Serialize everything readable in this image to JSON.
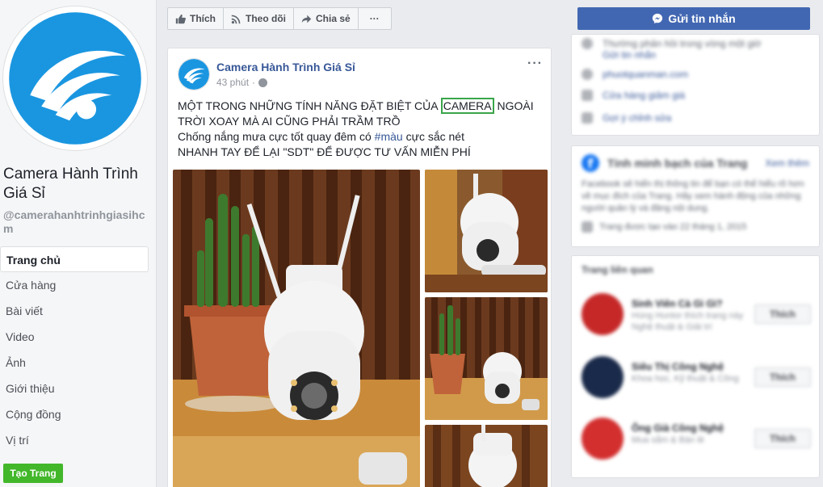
{
  "page": {
    "name": "Camera Hành Trình Giá Sỉ",
    "handle": "@camerahanhtrinhgiasihcm"
  },
  "nav": {
    "items": [
      "Trang chủ",
      "Cửa hàng",
      "Bài viết",
      "Video",
      "Ảnh",
      "Giới thiệu",
      "Cộng đồng",
      "Vị trí"
    ],
    "active_index": 0,
    "create_page": "Tạo Trang"
  },
  "actions": {
    "like": "Thích",
    "follow": "Theo dõi",
    "share": "Chia sẻ",
    "more": "···"
  },
  "post": {
    "author": "Camera Hành Trình Giá Sỉ",
    "time": "43 phút",
    "separator": "·",
    "more": "···",
    "line1_prefix": "MỘT TRONG NHỮNG TÍNH NĂNG ĐẶT BIỆT CỦA ",
    "line1_highlight": "CAMERA",
    "line1_suffix": " NGOÀI",
    "line2": "TRỜI XOAY MÀ AI CŨNG PHẢI TRẦM TRỒ",
    "line3_prefix": "Chống nắng mưa cực tốt quay đêm có ",
    "line3_hashtag": "#màu",
    "line3_suffix": " cực sắc nét",
    "line4": "NHANH TAY ĐỂ LẠI \"SDT\" ĐỂ ĐƯỢC TƯ VẤN MIỄN PHÍ"
  },
  "sidebar": {
    "message_button": "Gửi tin nhắn",
    "info_rows": [
      {
        "text": "Thường phản hồi trong vòng một giờ",
        "link": "Gửi tin nhắn"
      },
      {
        "text": "phuotquanman.com"
      },
      {
        "text": "Cửa hàng giảm giá"
      },
      {
        "text": "Gợi ý chỉnh sửa"
      }
    ],
    "transparency": {
      "title": "Tính minh bạch của Trang",
      "see_more": "Xem thêm",
      "body": "Facebook sẽ hiển thị thông tin để bạn có thể hiểu rõ hơn về mục đích của Trang. Hãy xem hành động của những người quản lý và đăng nội dung.",
      "created": "Trang được tạo vào 22 tháng 1, 2015"
    },
    "related": {
      "title": "Trang liên quan",
      "items": [
        {
          "name": "Sinh Viên Cà Gì Gì?",
          "sub1": "Hùng Huntor thích trang này",
          "sub2": "Nghệ thuật & Giải trí",
          "button": "Thích",
          "color": "#c62828"
        },
        {
          "name": "Siêu Thị Công Nghệ",
          "sub1": "Khoa học, Kỹ thuật & Công",
          "sub2": "",
          "button": "Thích",
          "color": "#1a2a4a"
        },
        {
          "name": "Ông Già Công Nghệ",
          "sub1": "Mua sắm & Bán lẻ",
          "sub2": "",
          "button": "Thích",
          "color": "#d32f2f"
        }
      ]
    }
  },
  "colors": {
    "brand_blue": "#4267b2",
    "link_blue": "#385898",
    "create_green": "#42b72a",
    "highlight_green": "#3aa54a"
  }
}
